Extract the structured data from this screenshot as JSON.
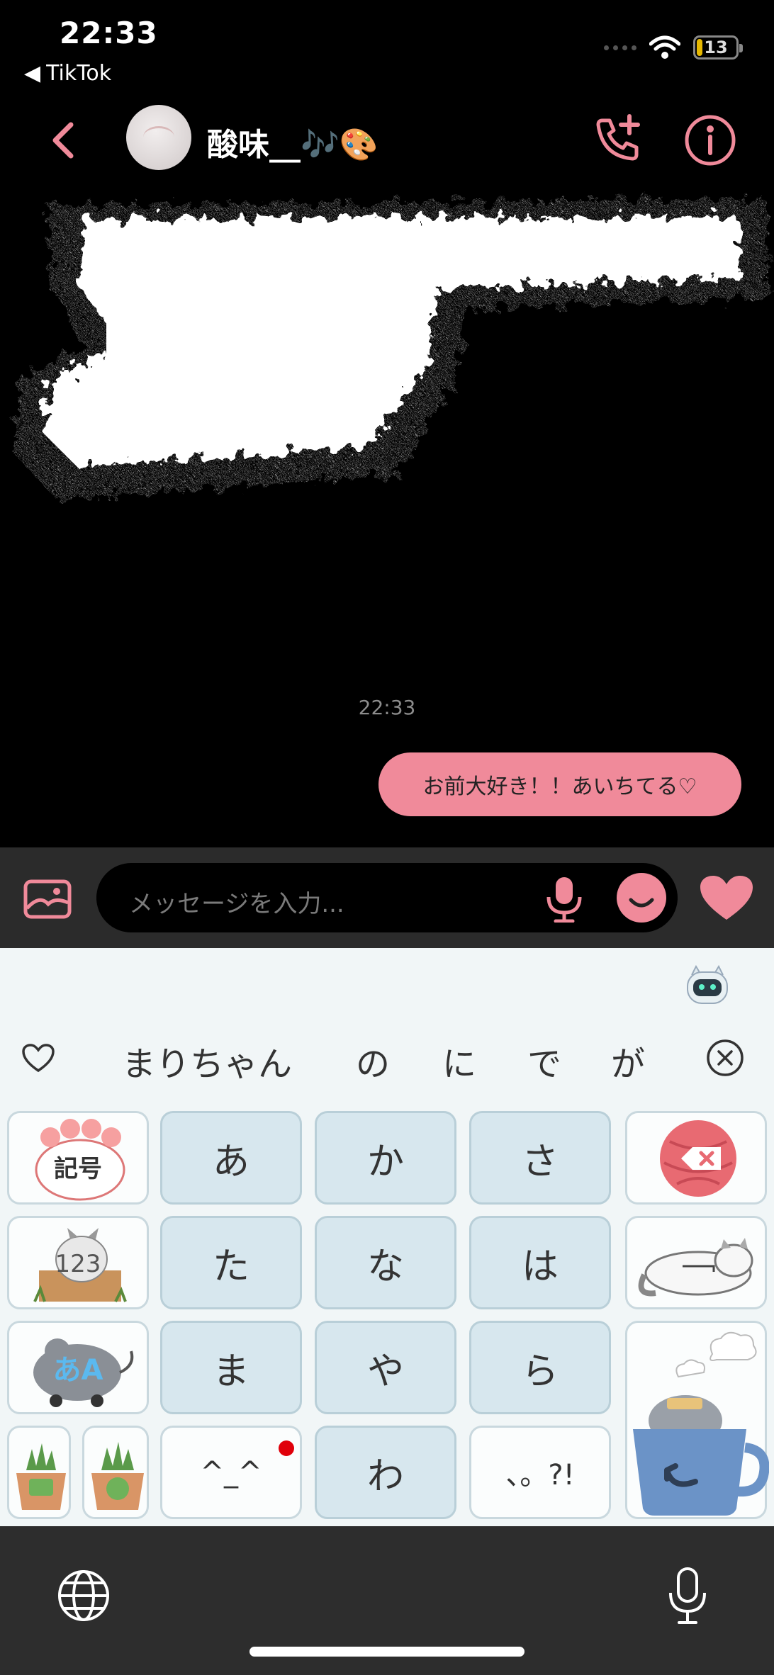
{
  "status_bar": {
    "time": "22:33",
    "back_app": "TikTok",
    "battery": "13"
  },
  "header": {
    "contact_name": "酸味__🎶🎨"
  },
  "messages": {
    "timestamp": "22:33",
    "sent_text": "お前大好き！！あいちてる♡"
  },
  "input": {
    "placeholder": "メッセージを入力..."
  },
  "keyboard": {
    "suggestions": [
      "まりちゃん",
      "の",
      "に",
      "で",
      "が"
    ],
    "keys": {
      "symbols": "記号",
      "a": "あ",
      "ka": "か",
      "sa": "さ",
      "num": "123",
      "ta": "た",
      "na": "な",
      "ha": "は",
      "mode": "あA",
      "ma": "ま",
      "ya": "や",
      "ra": "ら",
      "kaomoji": "^_^",
      "wa": "わ",
      "punct": "、。?!"
    }
  },
  "colors": {
    "accent_pink": "#f08a9a",
    "key_blue": "#d7e7ee",
    "keyboard_bg": "#f1f6f7"
  }
}
